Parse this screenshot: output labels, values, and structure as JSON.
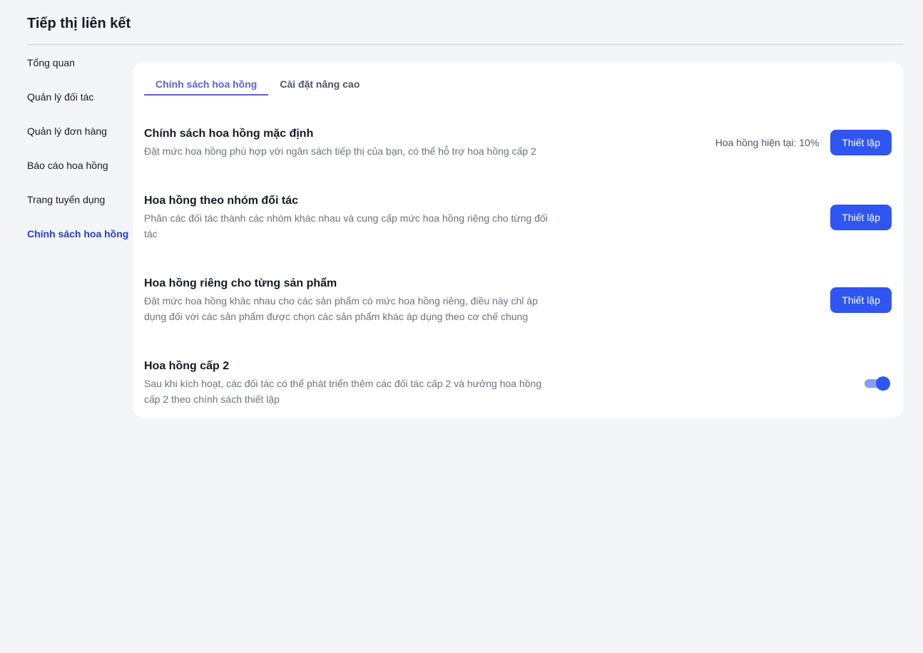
{
  "header": {
    "title": "Tiếp thị liên kết"
  },
  "sidebar": {
    "items": [
      {
        "label": "Tổng quan"
      },
      {
        "label": "Quản lý đối tác"
      },
      {
        "label": "Quản lý đơn hàng"
      },
      {
        "label": "Báo cáo hoa hồng"
      },
      {
        "label": "Trang tuyển dụng"
      },
      {
        "label": "Chính sách hoa hồng"
      }
    ],
    "active_index": 5
  },
  "tabs": [
    {
      "label": "Chính sách hoa hồng"
    },
    {
      "label": "Cài đặt nâng cao"
    }
  ],
  "sections": [
    {
      "title": "Chính sách hoa hồng mặc định",
      "description": "Đặt mức hoa hồng phù hợp với ngân sách tiếp thị của bạn, có thể hỗ trợ hoa hồng cấp 2",
      "current_rate": "Hoa hồng hiện tại: 10%",
      "button_label": "Thiết lập"
    },
    {
      "title": "Hoa hồng theo nhóm đối tác",
      "description": "Phân các đối tác thành các nhóm khác nhau và cung cấp mức hoa hồng riêng cho từng đối tác",
      "button_label": "Thiết lập"
    },
    {
      "title": "Hoa hồng riêng cho từng sản phẩm",
      "description": "Đặt mức hoa hồng khác nhau cho các sản phẩm có mức hoa hồng riêng, điều này chỉ áp dụng đối với các sản phẩm được chọn các sản phẩm khác áp dụng theo cơ chế chung",
      "button_label": "Thiết lập"
    },
    {
      "title": "Hoa hồng cấp 2",
      "description": "Sau khi kích hoạt, các đối tác có thể phát triển thêm các đối tác cấp 2 và hưởng hoa hồng cấp 2 theo chính sách thiết lập",
      "toggle_on": true
    }
  ],
  "colors": {
    "accent": "#2f56f2",
    "active_nav": "#2440c8",
    "active_tab": "#5a63d6",
    "background": "#f4f5f9"
  }
}
